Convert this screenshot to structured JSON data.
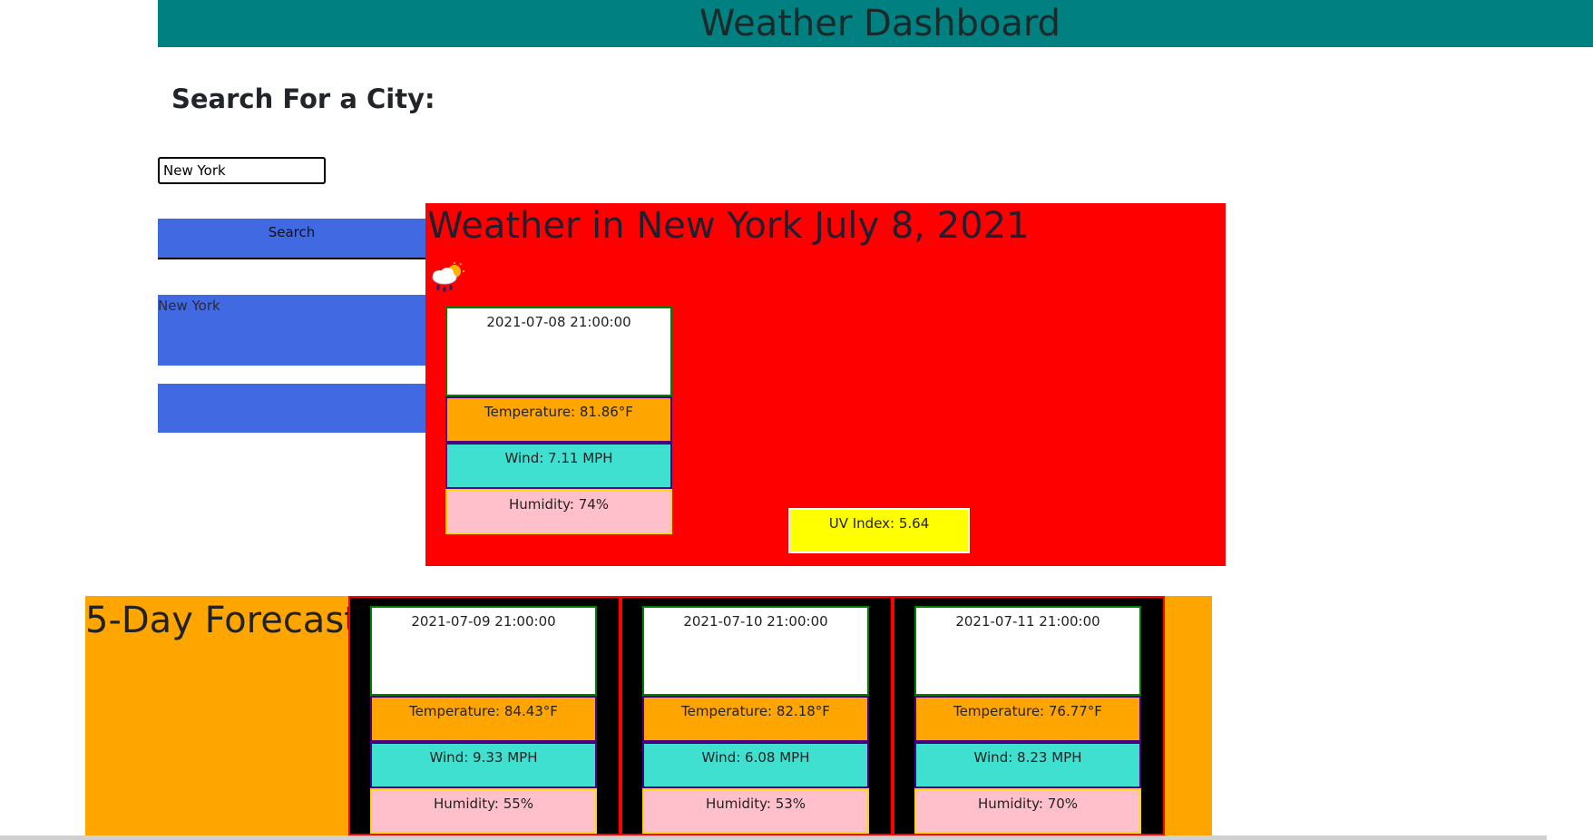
{
  "header": {
    "title": "Weather Dashboard"
  },
  "search": {
    "heading": "Search For a City:",
    "input_value": "New York",
    "button_label": "Search"
  },
  "history": [
    "New York",
    ""
  ],
  "current": {
    "title": "Weather in New York July 8, 2021",
    "icon": "rain-cloud-sun-icon",
    "card": {
      "date": "2021-07-08 21:00:00",
      "temperature": "Temperature: 81.86°F",
      "wind": "Wind: 7.11 MPH",
      "humidity": "Humidity: 74%"
    },
    "uv_index": "UV Index: 5.64"
  },
  "forecast": {
    "title": "5-Day Forecast",
    "days": [
      {
        "date": "2021-07-09 21:00:00",
        "temperature": "Temperature: 84.43°F",
        "wind": "Wind: 9.33 MPH",
        "humidity": "Humidity: 55%"
      },
      {
        "date": "2021-07-10 21:00:00",
        "temperature": "Temperature: 82.18°F",
        "wind": "Wind: 6.08 MPH",
        "humidity": "Humidity: 53%"
      },
      {
        "date": "2021-07-11 21:00:00",
        "temperature": "Temperature: 76.77°F",
        "wind": "Wind: 8.23 MPH",
        "humidity": "Humidity: 70%"
      }
    ]
  },
  "colors": {
    "header": "#008080",
    "button": "#4169e1",
    "current_panel": "#ff0000",
    "forecast_panel": "#ffa500",
    "temperature": "#ffa500",
    "wind": "#40e0d0",
    "humidity": "#ffc0cb",
    "uv": "#ffff00"
  }
}
